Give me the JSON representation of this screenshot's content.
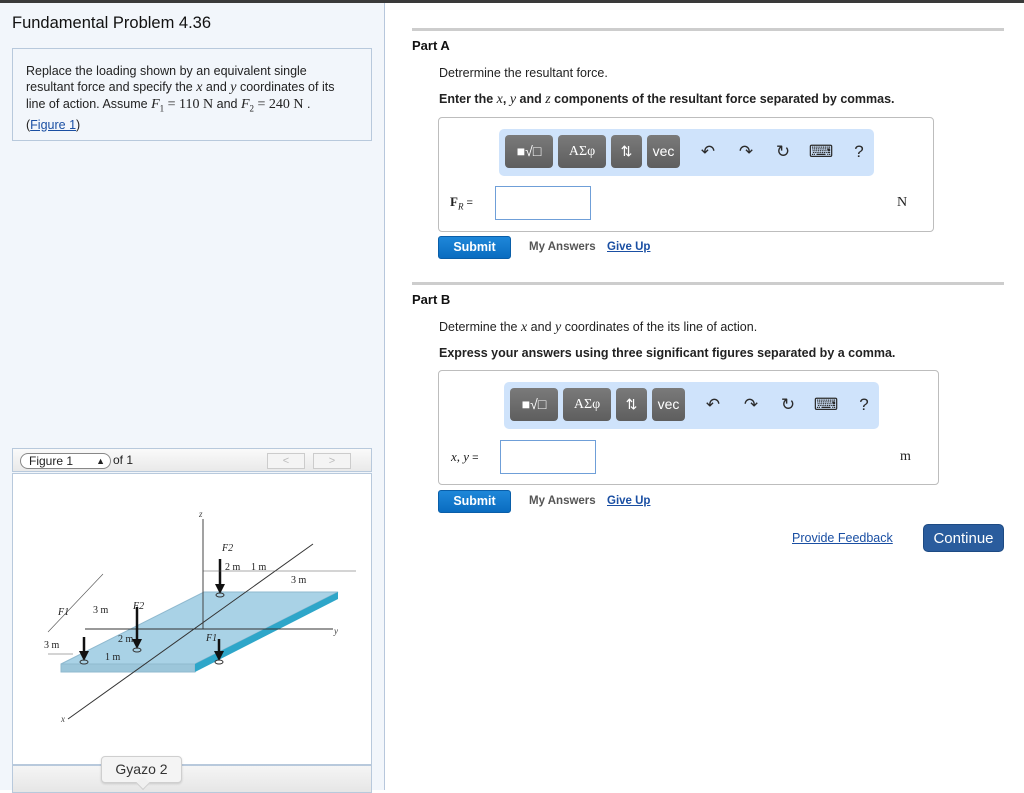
{
  "problem": {
    "title": "Fundamental Problem 4.36",
    "text_line1": "Replace the loading shown by an equivalent single",
    "text_line2_a": "resultant force and specify the ",
    "text_line2_x": "x",
    "text_line2_b": " and ",
    "text_line2_y": "y",
    "text_line2_c": " coordinates of its",
    "text_line3_a": "line of action. Assume ",
    "f1_sym": "F",
    "f1_sub": "1",
    "f1_val": " = 110 N",
    "and": " and ",
    "f2_sym": "F",
    "f2_sub": "2",
    "f2_val": " = 240 N",
    "period": " .",
    "figure_link_open": "(",
    "figure_link": "Figure 1",
    "figure_link_close": ")"
  },
  "figure_nav": {
    "selected": "Figure 1",
    "of_label": "of 1",
    "prev": "<",
    "next": ">"
  },
  "figure": {
    "labels": {
      "z": "z",
      "x": "x",
      "y": "y",
      "F1_left": "F1",
      "F1_right": "F1",
      "F2_left": "F2",
      "F2_top": "F2",
      "dim_2m_top": "2 m",
      "dim_1m_top": "1 m",
      "dim_3m_top": "3 m",
      "dim_3m_left_a": "3 m",
      "dim_3m_left_b": "3 m",
      "dim_2m_left": "2 m",
      "dim_1m_left": "1 m"
    },
    "plate_color": "#a9d2e6",
    "plate_edge_color": "#2ea6c9"
  },
  "tooltip": "Gyazo 2",
  "partA": {
    "heading": "Part A",
    "prompt": "Detrermine the resultant force.",
    "instruction_a": "Enter the ",
    "instruction_x": "x",
    "instruction_sep1": ", ",
    "instruction_y": "y",
    "instruction_and": " and ",
    "instruction_z": "z",
    "instruction_b": " components of the resultant force separated by commas.",
    "label_main": "F",
    "label_sub": "R",
    "label_eq": " =",
    "input_value": "",
    "unit": "N",
    "submit": "Submit",
    "my_answers": "My Answers",
    "give_up": "Give Up"
  },
  "partB": {
    "heading": "Part B",
    "prompt_a": "Determine the ",
    "prompt_x": "x",
    "prompt_and": " and ",
    "prompt_y": "y",
    "prompt_b": " coordinates of the its line of action.",
    "instruction": "Express your answers using three significant figures separated by a comma.",
    "label": "x, y",
    "label_eq": " =",
    "input_value": "",
    "unit": "m",
    "submit": "Submit",
    "my_answers": "My Answers",
    "give_up": "Give Up"
  },
  "toolbar": {
    "templates": "■√□",
    "greek": "ΑΣφ",
    "arrows": "⇅",
    "vec": "vec",
    "undo": "↶",
    "redo": "↷",
    "reset": "↻",
    "keyboard": "⌨",
    "help": "?"
  },
  "footer": {
    "feedback": "Provide Feedback",
    "continue": "Continue"
  },
  "colors": {
    "accent": "#0a6cc0",
    "continue": "#2a5c9d",
    "toolbar_bg": "#cfe3fb",
    "link": "#1a4fa3"
  }
}
